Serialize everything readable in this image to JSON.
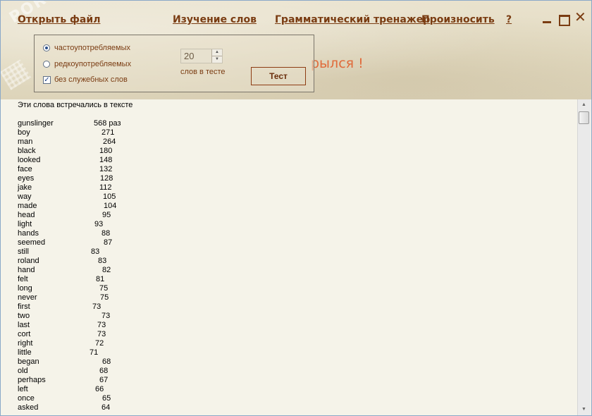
{
  "menu": {
    "open_file": "Открыть файл",
    "study_words": "Изучение слов",
    "grammar_trainer": "Грамматический тренажер",
    "pronounce": "Произносить",
    "help": "?"
  },
  "window_controls": {
    "minimize_icon": "minimize-icon",
    "maximize_icon": "maximize-icon",
    "close_icon": "close-icon",
    "close_glyph": "✕"
  },
  "banner_text": "рылся !",
  "options": {
    "frequent": "частоупотребляемых",
    "rare": "редкоупотребляемых",
    "no_function_words": "без служебных слов",
    "selected": "frequent",
    "no_function_words_checked": true
  },
  "word_count": {
    "value": "20",
    "caption": "слов в тесте"
  },
  "test_button": "Тест",
  "list": {
    "title": "Эти слова встречались в тексте",
    "words": [
      {
        "word": "gunslinger",
        "count": "568 раз"
      },
      {
        "word": "boy",
        "count": "271"
      },
      {
        "word": "man",
        "count": "264"
      },
      {
        "word": "black",
        "count": "180"
      },
      {
        "word": "looked",
        "count": "148"
      },
      {
        "word": "face",
        "count": "132"
      },
      {
        "word": "eyes",
        "count": "128"
      },
      {
        "word": "jake",
        "count": "112"
      },
      {
        "word": "way",
        "count": "105"
      },
      {
        "word": "made",
        "count": "104"
      },
      {
        "word": "head",
        "count": "95"
      },
      {
        "word": "light",
        "count": "93"
      },
      {
        "word": "hands",
        "count": "88"
      },
      {
        "word": "seemed",
        "count": "87"
      },
      {
        "word": "still",
        "count": "83"
      },
      {
        "word": "roland",
        "count": "83"
      },
      {
        "word": "hand",
        "count": "82"
      },
      {
        "word": "felt",
        "count": "81"
      },
      {
        "word": "long",
        "count": "75"
      },
      {
        "word": "never",
        "count": "75"
      },
      {
        "word": "first",
        "count": "73"
      },
      {
        "word": "two",
        "count": "73"
      },
      {
        "word": "last",
        "count": "73"
      },
      {
        "word": "cort",
        "count": "73"
      },
      {
        "word": "right",
        "count": "72"
      },
      {
        "word": "little",
        "count": "71"
      },
      {
        "word": "began",
        "count": "68"
      },
      {
        "word": "old",
        "count": "68"
      },
      {
        "word": "perhaps",
        "count": "67"
      },
      {
        "word": "left",
        "count": "66"
      },
      {
        "word": "once",
        "count": "65"
      },
      {
        "word": "asked",
        "count": "64"
      }
    ]
  },
  "colors": {
    "menu_text": "#7a3c12",
    "banner": "#e06a3a",
    "list_bg": "#f5f3e9"
  }
}
